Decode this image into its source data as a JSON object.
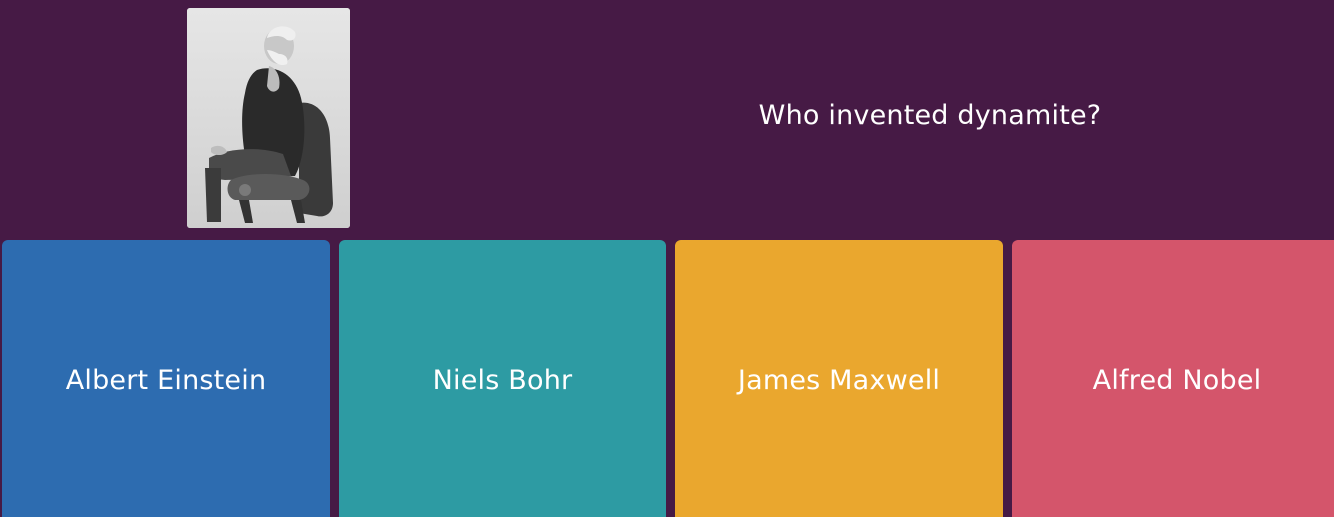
{
  "theme": {
    "background": "#461a45",
    "answer_colors": [
      "#2d6cb0",
      "#2d9ba3",
      "#eaa72e",
      "#d4556b"
    ]
  },
  "question": {
    "text": "Who invented dynamite?",
    "image": {
      "icon": "portrait-photo-icon"
    }
  },
  "answers": [
    {
      "label": "Albert Einstein"
    },
    {
      "label": "Niels Bohr"
    },
    {
      "label": "James Maxwell"
    },
    {
      "label": "Alfred Nobel"
    }
  ]
}
